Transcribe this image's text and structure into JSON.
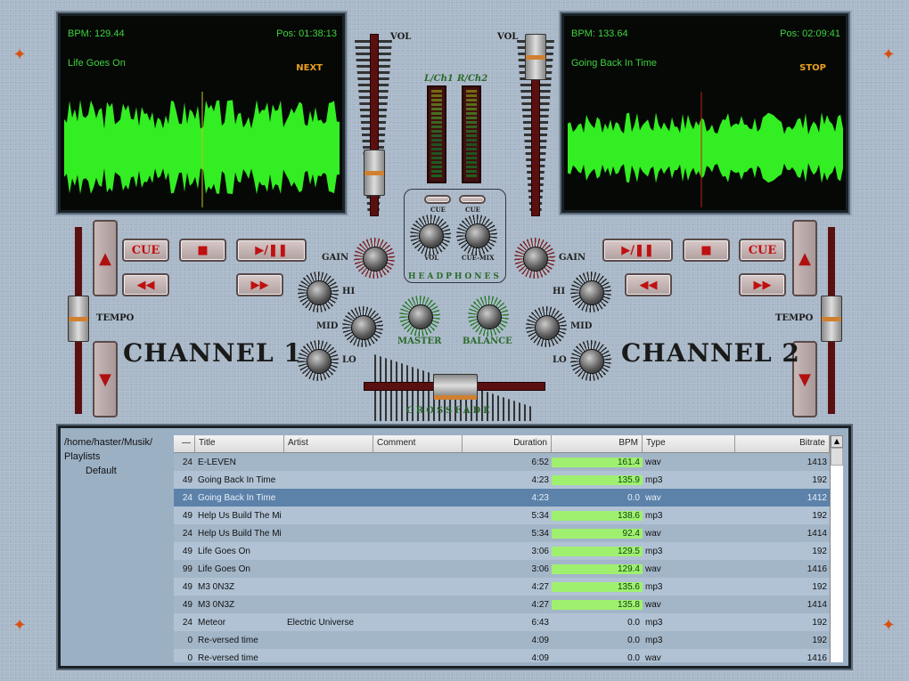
{
  "deck1": {
    "bpm": "BPM: 129.44",
    "pos": "Pos: 01:38:13",
    "title": "Life Goes On",
    "status": "NEXT",
    "channel": "CHANNEL 1",
    "cue": "CUE",
    "tempo": "TEMPO",
    "gain": "GAIN",
    "hi": "HI",
    "mid": "MID",
    "lo": "LO"
  },
  "deck2": {
    "bpm": "BPM: 133.64",
    "pos": "Pos: 02:09:41",
    "title": "Going Back In Time",
    "status": "STOP",
    "channel": "CHANNEL 2",
    "cue": "CUE",
    "tempo": "TEMPO",
    "gain": "GAIN",
    "hi": "HI",
    "mid": "MID",
    "lo": "LO"
  },
  "mixer": {
    "vol": "VOL",
    "vu_left": "L/Ch1",
    "vu_right": "R/Ch2",
    "cue": "CUE",
    "hp_vol": "VOL",
    "cue_mix": "CUE-MIX",
    "headphones": "HEADPHONES",
    "master": "MASTER",
    "balance": "BALANCE",
    "crossfade": "CROSSFADE"
  },
  "library": {
    "tree": [
      "/home/haster/Musik/",
      "Playlists",
      "Default"
    ],
    "columns": [
      "—",
      "Title",
      "Artist",
      "Comment",
      "Duration",
      "BPM",
      "Type",
      "Bitrate"
    ],
    "rows": [
      [
        "24",
        "E-LEVEN",
        "",
        "",
        "6:52",
        "161.4",
        "wav",
        "1413",
        true
      ],
      [
        "49",
        "Going Back In Time",
        "",
        "",
        "4:23",
        "135.9",
        "mp3",
        "192",
        true
      ],
      [
        "24",
        "Going Back In Time",
        "",
        "",
        "4:23",
        "0.0",
        "wav",
        "1412",
        false
      ],
      [
        "49",
        "Help Us Build The Mi",
        "",
        "",
        "5:34",
        "138.6",
        "mp3",
        "192",
        true
      ],
      [
        "24",
        "Help Us Build The Mi",
        "",
        "",
        "5:34",
        "92.4",
        "wav",
        "1414",
        true
      ],
      [
        "49",
        "Life Goes On",
        "",
        "",
        "3:06",
        "129.5",
        "mp3",
        "192",
        true
      ],
      [
        "99",
        "Life Goes On",
        "",
        "",
        "3:06",
        "129.4",
        "wav",
        "1416",
        true
      ],
      [
        "49",
        "M3 0N3Z",
        "",
        "",
        "4:27",
        "135.6",
        "mp3",
        "192",
        true
      ],
      [
        "49",
        "M3 0N3Z",
        "",
        "",
        "4:27",
        "135.8",
        "wav",
        "1414",
        true
      ],
      [
        "24",
        "Meteor",
        "Electric Universe",
        "",
        "6:43",
        "0.0",
        "mp3",
        "192",
        false
      ],
      [
        "0",
        "Re-versed time",
        "",
        "",
        "4:09",
        "0.0",
        "mp3",
        "192",
        false
      ],
      [
        "0",
        "Re-versed time",
        "",
        "",
        "4:09",
        "0.0",
        "wav",
        "1416",
        false
      ]
    ],
    "selected_index": 2
  },
  "colors": {
    "waveform": "#33ee22",
    "accent": "#c01010",
    "bpm_highlight": "#a0f070"
  }
}
